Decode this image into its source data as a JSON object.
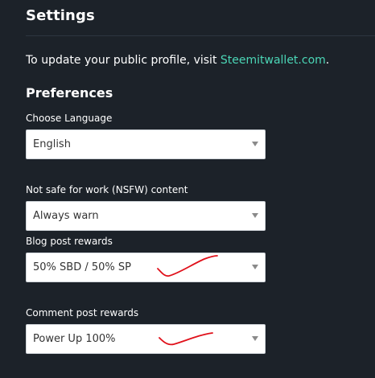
{
  "settings": {
    "title": "Settings",
    "profile_text": "To update your public profile, visit ",
    "profile_link": "Steemitwallet.com",
    "profile_suffix": "."
  },
  "preferences": {
    "heading": "Preferences",
    "language": {
      "label": "Choose Language",
      "value": "English"
    },
    "nsfw": {
      "label": "Not safe for work (NSFW) content",
      "value": "Always warn"
    },
    "blog_rewards": {
      "label": "Blog post rewards",
      "value": "50% SBD / 50% SP"
    },
    "comment_rewards": {
      "label": "Comment post rewards",
      "value": "Power Up 100%"
    }
  },
  "colors": {
    "background": "#1c2229",
    "link": "#4bd6b6",
    "scribble": "#e0101a"
  }
}
